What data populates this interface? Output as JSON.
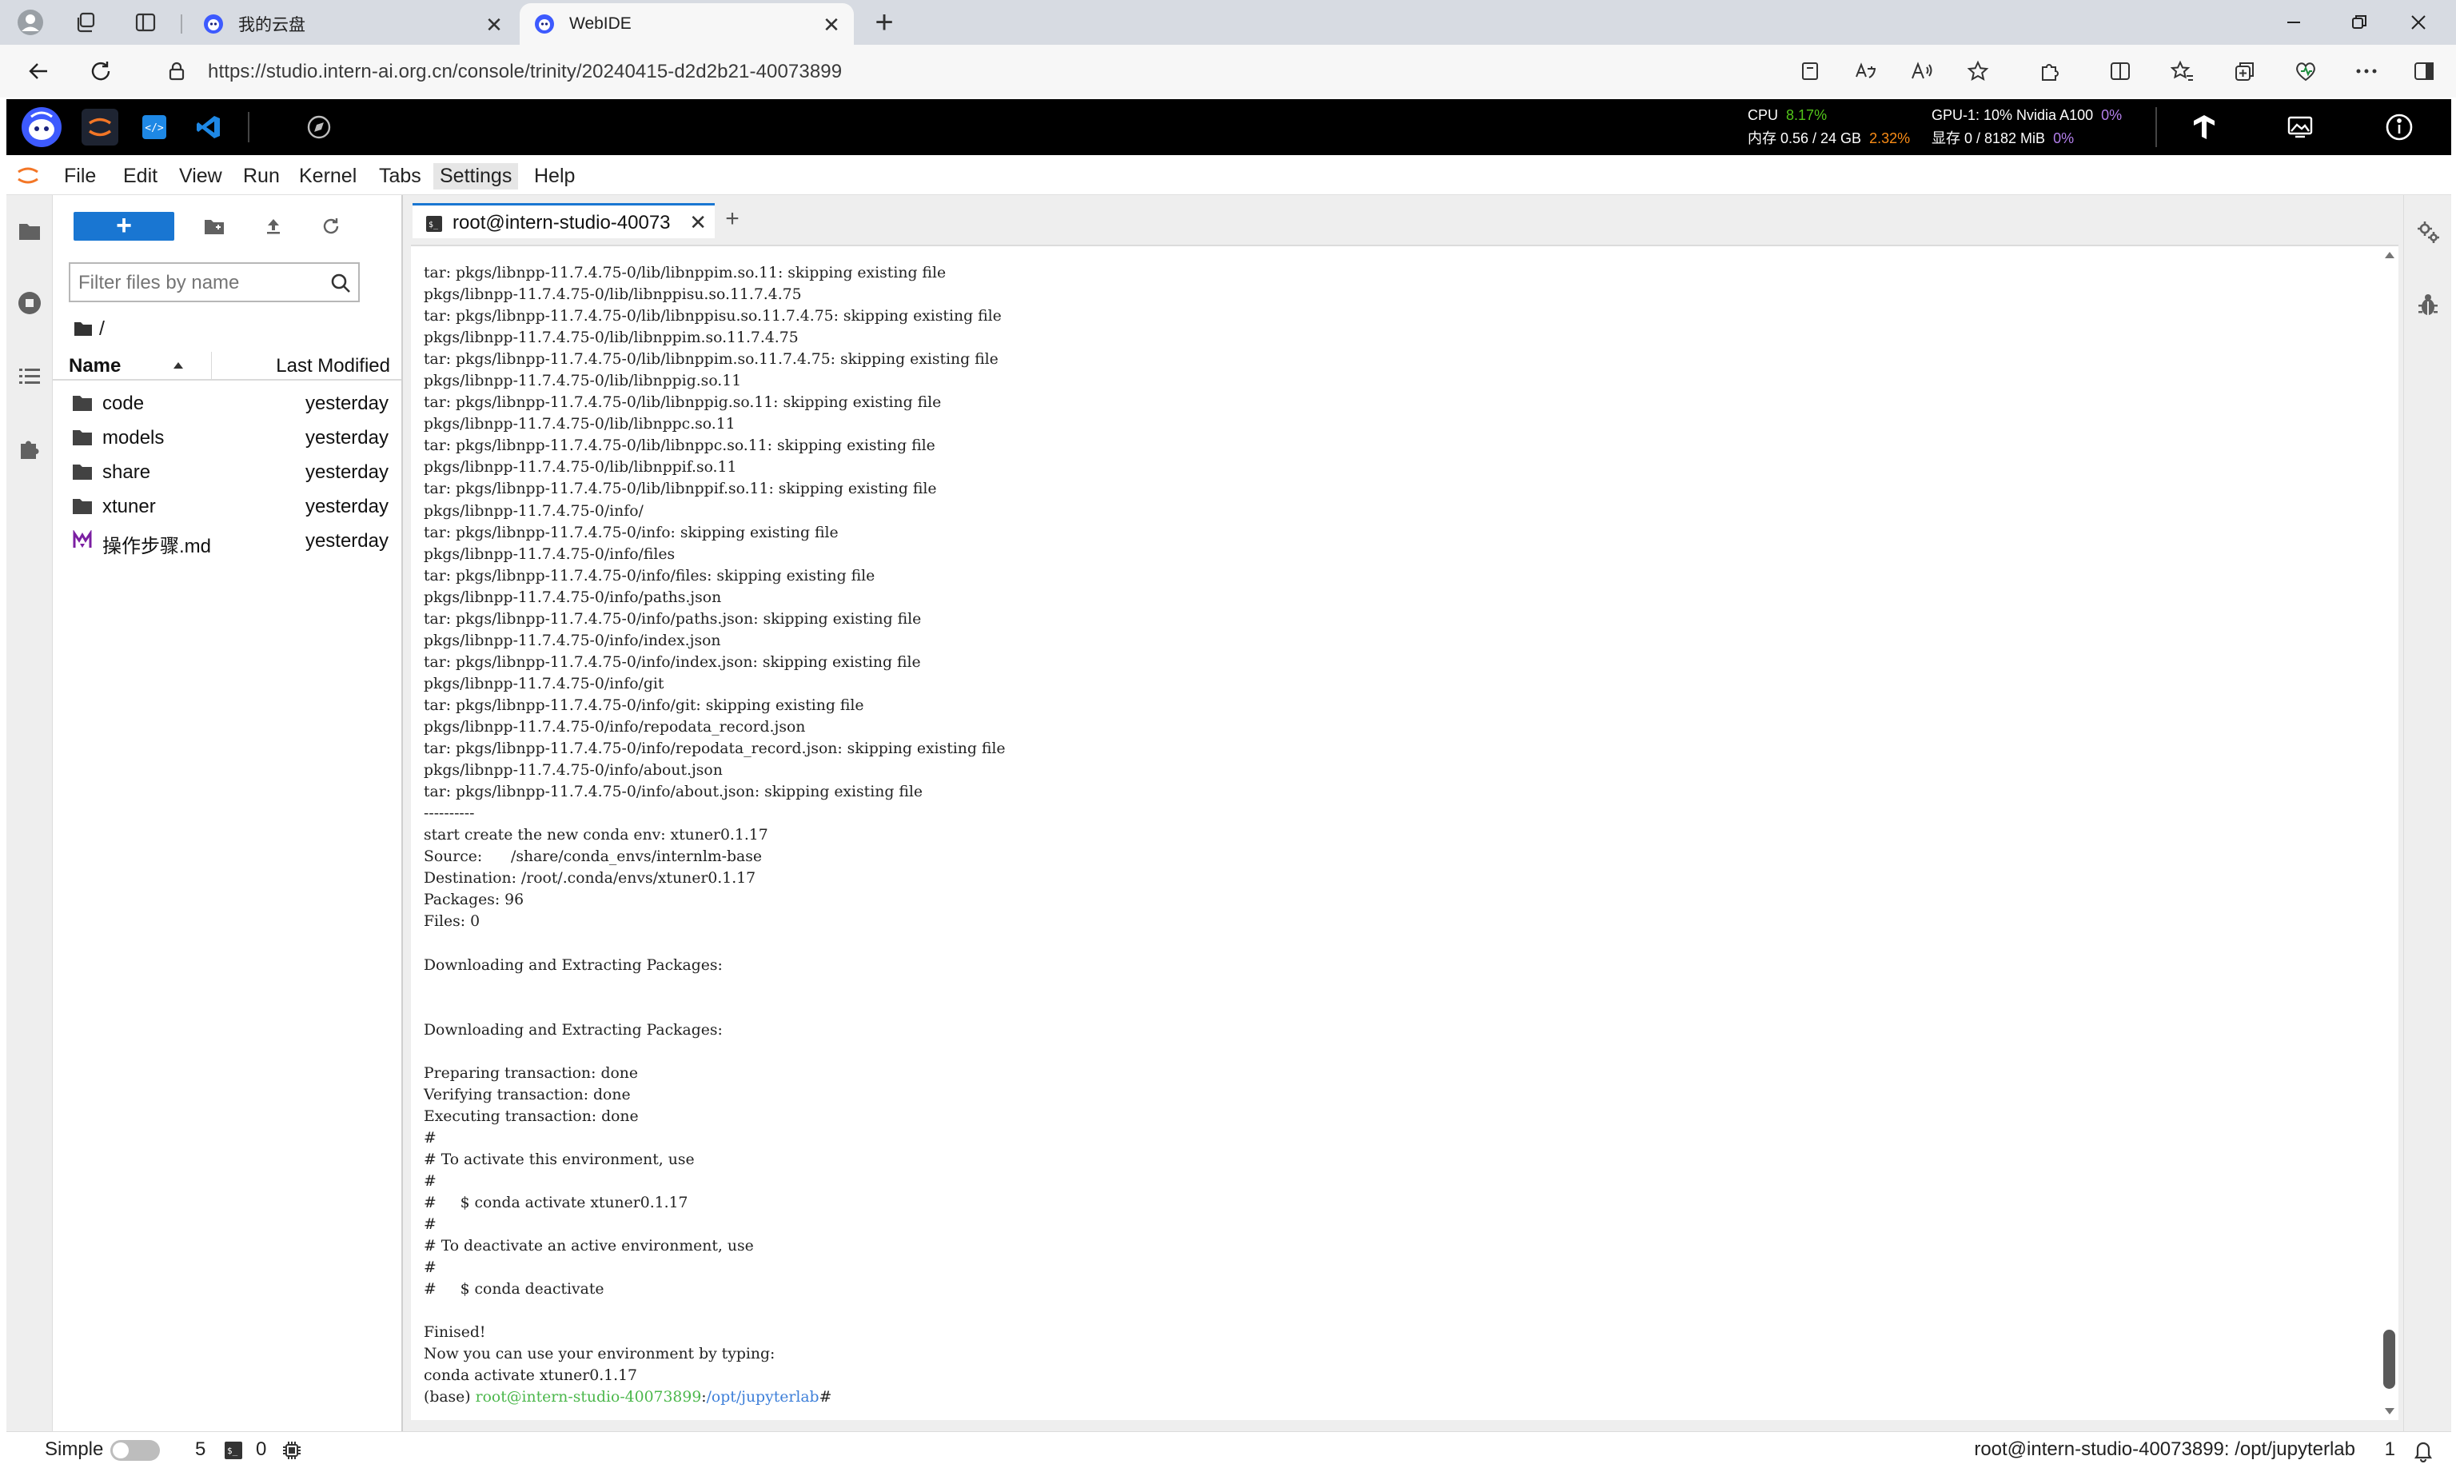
{
  "browser": {
    "tabs": [
      {
        "title": "我的云盘",
        "active": false
      },
      {
        "title": "WebIDE",
        "active": true
      }
    ],
    "new_tab_label": "+",
    "close_glyph": "✕",
    "url": "https://studio.intern-ai.org.cn/console/trinity/20240415-d2d2b21-40073899"
  },
  "studio": {
    "cpu_label": "CPU",
    "cpu_value": "8.17%",
    "mem_label": "内存 0.56 / 24 GB",
    "mem_value": "2.32%",
    "gpu_label": "GPU-1: 10% Nvidia A100",
    "gpu_value": "0%",
    "vram_label": "显存 0 / 8182 MiB",
    "vram_value": "0%"
  },
  "menu": [
    "File",
    "Edit",
    "View",
    "Run",
    "Kernel",
    "Tabs",
    "Settings",
    "Help"
  ],
  "menu_active": "Settings",
  "filebrowser": {
    "new_label": "+",
    "filter_placeholder": "Filter files by name",
    "breadcrumb": "/",
    "col_name": "Name",
    "col_modified": "Last Modified",
    "items": [
      {
        "name": "code",
        "modified": "yesterday",
        "type": "folder"
      },
      {
        "name": "models",
        "modified": "yesterday",
        "type": "folder"
      },
      {
        "name": "share",
        "modified": "yesterday",
        "type": "folder"
      },
      {
        "name": "xtuner",
        "modified": "yesterday",
        "type": "folder"
      },
      {
        "name": "操作步骤.md",
        "modified": "yesterday",
        "type": "markdown"
      }
    ]
  },
  "dock": {
    "tab_label": "root@intern-studio-40073",
    "tab_close": "✕",
    "add_label": "+"
  },
  "terminal": {
    "lines": [
      "tar: pkgs/libnpp-11.7.4.75-0/lib/libnppim.so.11: skipping existing file",
      "pkgs/libnpp-11.7.4.75-0/lib/libnppisu.so.11.7.4.75",
      "tar: pkgs/libnpp-11.7.4.75-0/lib/libnppisu.so.11.7.4.75: skipping existing file",
      "pkgs/libnpp-11.7.4.75-0/lib/libnppim.so.11.7.4.75",
      "tar: pkgs/libnpp-11.7.4.75-0/lib/libnppim.so.11.7.4.75: skipping existing file",
      "pkgs/libnpp-11.7.4.75-0/lib/libnppig.so.11",
      "tar: pkgs/libnpp-11.7.4.75-0/lib/libnppig.so.11: skipping existing file",
      "pkgs/libnpp-11.7.4.75-0/lib/libnppc.so.11",
      "tar: pkgs/libnpp-11.7.4.75-0/lib/libnppc.so.11: skipping existing file",
      "pkgs/libnpp-11.7.4.75-0/lib/libnppif.so.11",
      "tar: pkgs/libnpp-11.7.4.75-0/lib/libnppif.so.11: skipping existing file",
      "pkgs/libnpp-11.7.4.75-0/info/",
      "tar: pkgs/libnpp-11.7.4.75-0/info: skipping existing file",
      "pkgs/libnpp-11.7.4.75-0/info/files",
      "tar: pkgs/libnpp-11.7.4.75-0/info/files: skipping existing file",
      "pkgs/libnpp-11.7.4.75-0/info/paths.json",
      "tar: pkgs/libnpp-11.7.4.75-0/info/paths.json: skipping existing file",
      "pkgs/libnpp-11.7.4.75-0/info/index.json",
      "tar: pkgs/libnpp-11.7.4.75-0/info/index.json: skipping existing file",
      "pkgs/libnpp-11.7.4.75-0/info/git",
      "tar: pkgs/libnpp-11.7.4.75-0/info/git: skipping existing file",
      "pkgs/libnpp-11.7.4.75-0/info/repodata_record.json",
      "tar: pkgs/libnpp-11.7.4.75-0/info/repodata_record.json: skipping existing file",
      "pkgs/libnpp-11.7.4.75-0/info/about.json",
      "tar: pkgs/libnpp-11.7.4.75-0/info/about.json: skipping existing file",
      "----------",
      "start create the new conda env: xtuner0.1.17",
      "Source:      /share/conda_envs/internlm-base",
      "Destination: /root/.conda/envs/xtuner0.1.17",
      "Packages: 96",
      "Files: 0",
      "",
      "Downloading and Extracting Packages:",
      "",
      "",
      "Downloading and Extracting Packages:",
      "",
      "Preparing transaction: done",
      "Verifying transaction: done",
      "Executing transaction: done",
      "#",
      "# To activate this environment, use",
      "#",
      "#     $ conda activate xtuner0.1.17",
      "#",
      "# To deactivate an active environment, use",
      "#",
      "#     $ conda deactivate",
      "",
      "Finised!",
      "Now you can use your environment by typing:",
      "conda activate xtuner0.1.17"
    ],
    "prompt_env": "(base) ",
    "prompt_user": "root@intern-studio-40073899",
    "prompt_sep": ":",
    "prompt_path": "/opt/jupyterlab",
    "prompt_end": "#"
  },
  "statusbar": {
    "simple_label": "Simple",
    "terminals_count": "5",
    "kernels_count": "0",
    "right_text": "root@intern-studio-40073899: /opt/jupyterlab",
    "notif_count": "1"
  },
  "colors": {
    "accent": "#1976d2",
    "studio_bg": "#000000",
    "cpu_green": "#52c41a",
    "mem_orange": "#fa8c16",
    "gpu_purple": "#b37feb",
    "prompt_green": "#4bb74b",
    "prompt_blue": "#3d7fd9"
  }
}
